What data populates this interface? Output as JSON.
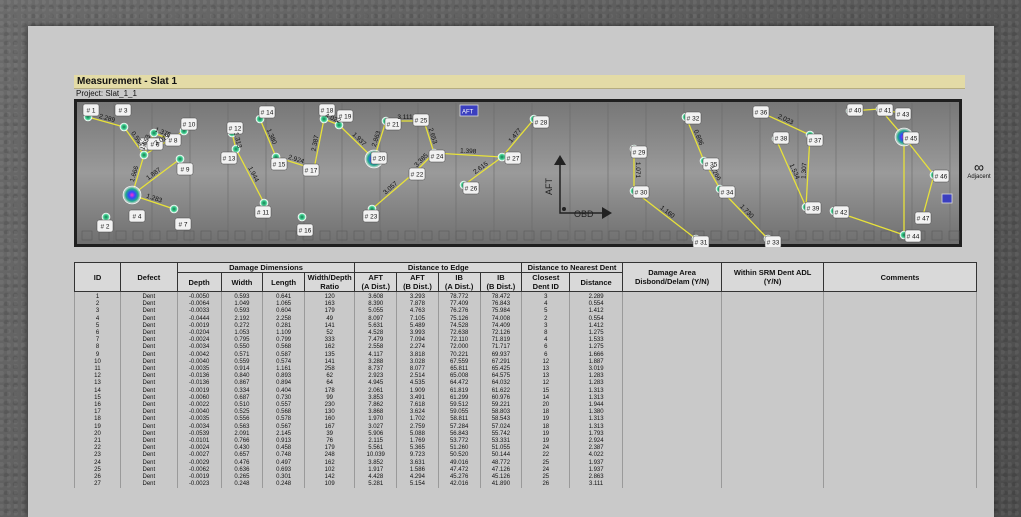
{
  "header": {
    "title": "Measurement - Slat 1",
    "project": "Project: Slat_1_1"
  },
  "scan": {
    "orientation": {
      "aft": "AFT",
      "obd": "OBD",
      "aft_badge": "AFT"
    },
    "dents": [
      {
        "id": "# 1"
      },
      {
        "id": "# 2"
      },
      {
        "id": "# 3"
      },
      {
        "id": "# 4"
      },
      {
        "id": "# 5"
      },
      {
        "id": "# 6"
      },
      {
        "id": "# 7"
      },
      {
        "id": "# 8"
      },
      {
        "id": "# 9"
      },
      {
        "id": "# 10"
      },
      {
        "id": "# 11"
      },
      {
        "id": "# 12"
      },
      {
        "id": "# 13"
      },
      {
        "id": "# 14"
      },
      {
        "id": "# 15"
      },
      {
        "id": "# 16"
      },
      {
        "id": "# 17"
      },
      {
        "id": "# 18"
      },
      {
        "id": "# 19"
      },
      {
        "id": "# 20"
      },
      {
        "id": "# 21"
      },
      {
        "id": "# 22"
      },
      {
        "id": "# 23"
      },
      {
        "id": "# 24"
      },
      {
        "id": "# 25"
      },
      {
        "id": "# 26"
      },
      {
        "id": "# 27"
      },
      {
        "id": "# 28"
      },
      {
        "id": "# 29"
      },
      {
        "id": "# 30"
      },
      {
        "id": "# 31"
      },
      {
        "id": "# 32"
      },
      {
        "id": "# 33"
      },
      {
        "id": "# 34"
      },
      {
        "id": "# 35"
      },
      {
        "id": "# 36"
      },
      {
        "id": "# 37"
      },
      {
        "id": "# 38"
      },
      {
        "id": "# 39"
      },
      {
        "id": "# 40"
      },
      {
        "id": "# 41"
      },
      {
        "id": "# 42"
      },
      {
        "id": "# 43"
      },
      {
        "id": "# 44"
      },
      {
        "id": "# 45"
      },
      {
        "id": "# 46"
      },
      {
        "id": "# 47"
      }
    ],
    "distances": [
      "2.289",
      "0.554",
      "1.653",
      "1.375",
      "1.666",
      "1.887",
      "3.019",
      "1.283",
      "1.313",
      "1.944",
      "1.380",
      "2.924",
      "2.387",
      "4.022",
      "1.937",
      "2.863",
      "3.111",
      "2.653",
      "3.385",
      "3.057",
      "1.398",
      "2.615",
      "1.477",
      "1.071",
      "1.160",
      "0.896",
      "1.266",
      "1.730",
      "2.023",
      "1.307",
      "1.534"
    ]
  },
  "right_tab": {
    "label": "Adjacent"
  },
  "table": {
    "groups": {
      "damage_dimensions": "Damage Dimensions",
      "distance_to_edge": "Distance to Edge",
      "distance_to_nearest": "Distance to Nearest Dent"
    },
    "columns": {
      "id": "ID",
      "defect": "Defect",
      "depth": "Depth",
      "width": "Width",
      "length": "Length",
      "ratio": "Width/Depth Ratio",
      "aft_a": "AFT\n(A Dist.)",
      "aft_b": "AFT\n(B Dist.)",
      "ib_a": "IB\n(A Dist.)",
      "ib_b": "IB\n(B Dist.)",
      "closest": "Closest\nDent ID",
      "distance": "Distance",
      "damage_area": "Damage Area\nDisbond/Delam (Y/N)",
      "srm": "Within SRM Dent ADL\n(Y/N)",
      "comments": "Comments"
    },
    "rows": [
      [
        "1",
        "Dent",
        "-0.0050",
        "0.593",
        "0.641",
        "120",
        "3.608",
        "3.293",
        "78.772",
        "78.472",
        "3",
        "2.289"
      ],
      [
        "2",
        "Dent",
        "-0.0064",
        "1.049",
        "1.065",
        "163",
        "8.390",
        "7.878",
        "77.409",
        "76.843",
        "4",
        "0.554"
      ],
      [
        "3",
        "Dent",
        "-0.0033",
        "0.593",
        "0.604",
        "179",
        "5.055",
        "4.763",
        "76.276",
        "75.984",
        "5",
        "1.412"
      ],
      [
        "4",
        "Dent",
        "-0.0444",
        "2.192",
        "2.258",
        "49",
        "8.097",
        "7.105",
        "75.126",
        "74.008",
        "2",
        "0.554"
      ],
      [
        "5",
        "Dent",
        "-0.0019",
        "0.272",
        "0.281",
        "141",
        "5.631",
        "5.489",
        "74.528",
        "74.409",
        "3",
        "1.412"
      ],
      [
        "6",
        "Dent",
        "-0.0204",
        "1.053",
        "1.109",
        "52",
        "4.528",
        "3.993",
        "72.638",
        "72.126",
        "8",
        "1.275"
      ],
      [
        "7",
        "Dent",
        "-0.0024",
        "0.795",
        "0.799",
        "333",
        "7.479",
        "7.094",
        "72.110",
        "71.819",
        "4",
        "1.533"
      ],
      [
        "8",
        "Dent",
        "-0.0034",
        "0.550",
        "0.568",
        "162",
        "2.558",
        "2.274",
        "72.000",
        "71.717",
        "6",
        "1.275"
      ],
      [
        "9",
        "Dent",
        "-0.0042",
        "0.571",
        "0.587",
        "135",
        "4.117",
        "3.818",
        "70.221",
        "69.937",
        "6",
        "1.666"
      ],
      [
        "10",
        "Dent",
        "-0.0040",
        "0.559",
        "0.574",
        "141",
        "3.288",
        "3.028",
        "67.559",
        "67.291",
        "12",
        "1.887"
      ],
      [
        "11",
        "Dent",
        "-0.0035",
        "0.914",
        "1.161",
        "258",
        "8.737",
        "8.077",
        "65.811",
        "65.425",
        "13",
        "3.019"
      ],
      [
        "12",
        "Dent",
        "-0.0136",
        "0.840",
        "0.893",
        "62",
        "2.923",
        "2.514",
        "65.008",
        "64.575",
        "13",
        "1.283"
      ],
      [
        "13",
        "Dent",
        "-0.0136",
        "0.867",
        "0.894",
        "64",
        "4.945",
        "4.535",
        "64.472",
        "64.032",
        "12",
        "1.283"
      ],
      [
        "14",
        "Dent",
        "-0.0019",
        "0.334",
        "0.404",
        "178",
        "2.061",
        "1.909",
        "61.819",
        "61.622",
        "15",
        "1.313"
      ],
      [
        "15",
        "Dent",
        "-0.0060",
        "0.687",
        "0.730",
        "99",
        "3.853",
        "3.491",
        "61.299",
        "60.976",
        "14",
        "1.313"
      ],
      [
        "16",
        "Dent",
        "-0.0022",
        "0.510",
        "0.557",
        "230",
        "7.862",
        "7.618",
        "59.512",
        "59.221",
        "20",
        "1.944"
      ],
      [
        "17",
        "Dent",
        "-0.0040",
        "0.525",
        "0.568",
        "130",
        "3.868",
        "3.624",
        "59.055",
        "58.803",
        "18",
        "1.380"
      ],
      [
        "18",
        "Dent",
        "-0.0035",
        "0.556",
        "0.578",
        "160",
        "1.970",
        "1.702",
        "58.811",
        "58.543",
        "19",
        "1.313"
      ],
      [
        "19",
        "Dent",
        "-0.0034",
        "0.563",
        "0.567",
        "167",
        "3.027",
        "2.759",
        "57.284",
        "57.024",
        "18",
        "1.313"
      ],
      [
        "20",
        "Dent",
        "-0.0539",
        "2.091",
        "2.145",
        "39",
        "5.906",
        "5.088",
        "56.843",
        "55.742",
        "19",
        "1.793"
      ],
      [
        "21",
        "Dent",
        "-0.0101",
        "0.766",
        "0.913",
        "76",
        "2.115",
        "1.769",
        "53.772",
        "53.331",
        "19",
        "2.924"
      ],
      [
        "22",
        "Dent",
        "-0.0024",
        "0.430",
        "0.458",
        "179",
        "5.561",
        "5.365",
        "51.260",
        "51.055",
        "24",
        "2.387"
      ],
      [
        "23",
        "Dent",
        "-0.0027",
        "0.657",
        "0.748",
        "248",
        "10.039",
        "9.723",
        "50.520",
        "50.144",
        "22",
        "4.022"
      ],
      [
        "24",
        "Dent",
        "-0.0029",
        "0.476",
        "0.497",
        "162",
        "3.852",
        "3.631",
        "49.016",
        "48.772",
        "25",
        "1.937"
      ],
      [
        "25",
        "Dent",
        "-0.0062",
        "0.636",
        "0.693",
        "102",
        "1.917",
        "1.586",
        "47.472",
        "47.126",
        "24",
        "1.937"
      ],
      [
        "26",
        "Dent",
        "-0.0019",
        "0.265",
        "0.301",
        "142",
        "4.428",
        "4.294",
        "45.276",
        "45.126",
        "25",
        "2.863"
      ],
      [
        "27",
        "Dent",
        "-0.0023",
        "0.248",
        "0.248",
        "109",
        "5.281",
        "5.154",
        "42.016",
        "41.890",
        "26",
        "3.111"
      ]
    ]
  }
}
